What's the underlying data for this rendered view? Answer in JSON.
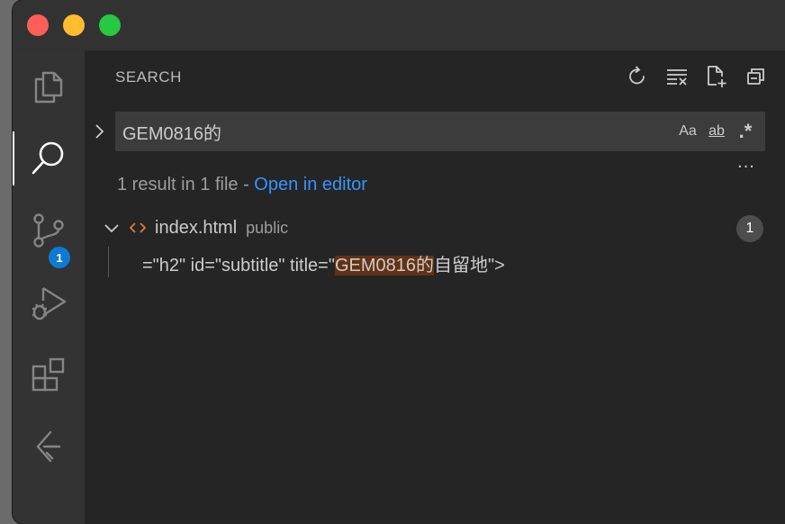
{
  "window": {
    "traffic_lights": {
      "close_color": "#ff5f57",
      "minimize_color": "#febc2e",
      "maximize_color": "#28c840"
    }
  },
  "activity_bar": {
    "items": [
      {
        "name": "explorer",
        "icon": "files-icon"
      },
      {
        "name": "search",
        "icon": "search-icon",
        "active": true
      },
      {
        "name": "source-control",
        "icon": "source-control-icon",
        "badge": "1"
      },
      {
        "name": "run-debug",
        "icon": "debug-icon"
      },
      {
        "name": "extensions",
        "icon": "extensions-icon"
      },
      {
        "name": "remote",
        "icon": "remote-icon"
      }
    ],
    "badge_color": "#0e7ad1"
  },
  "sidebar": {
    "title": "SEARCH",
    "actions": [
      "refresh-icon",
      "clear-results-icon",
      "new-search-editor-icon",
      "collapse-all-icon"
    ]
  },
  "search": {
    "query": "GEM0816的",
    "options": {
      "match_case": "Aa",
      "whole_word": "ab",
      "regex": ".*"
    },
    "more": "..."
  },
  "results": {
    "summary_text": "1 result in 1 file - ",
    "open_in_editor": "Open in editor",
    "link_color": "#3794ff",
    "files": [
      {
        "name": "index.html",
        "dir": "public",
        "count": "1",
        "icon": "html-file-icon",
        "matches": [
          {
            "before": "=\"h2\" id=\"subtitle\" title=\"",
            "match": "GEM0816的",
            "after": "自留地\">"
          }
        ]
      }
    ],
    "highlight_color": "#613214"
  }
}
